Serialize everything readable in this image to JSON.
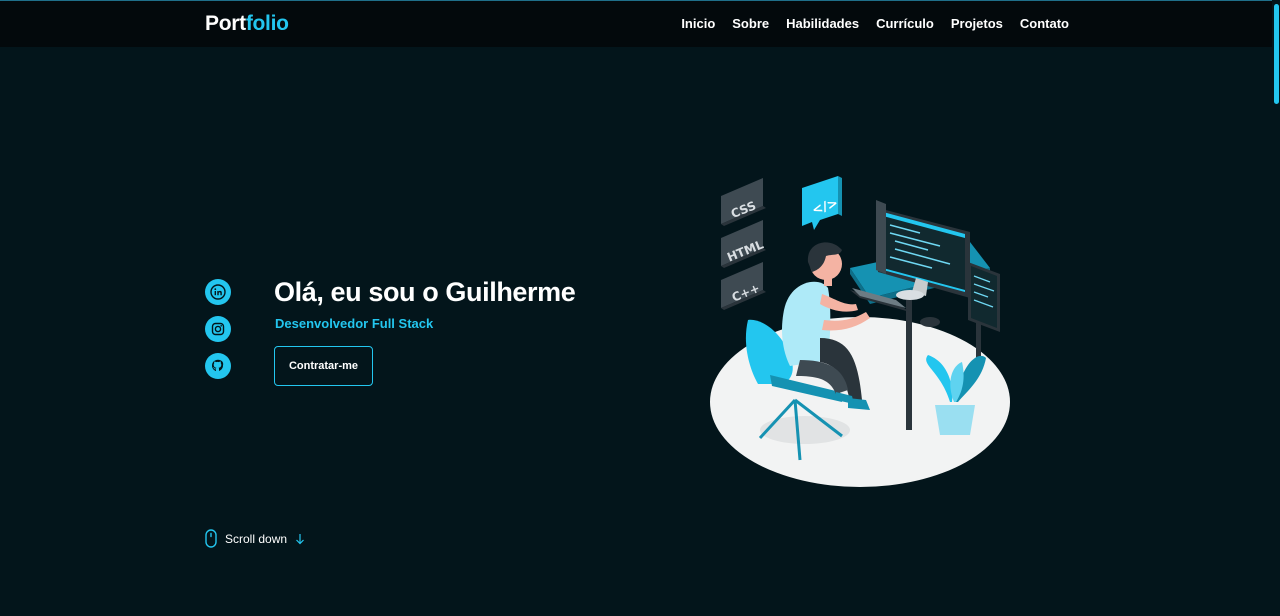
{
  "header": {
    "logo_part1": "Port",
    "logo_part2": "folio",
    "nav": [
      "Inicio",
      "Sobre",
      "Habilidades",
      "Currículo",
      "Projetos",
      "Contato"
    ]
  },
  "hero": {
    "title": "Olá, eu sou o Guilherme",
    "subtitle": "Desenvolvedor Full Stack",
    "cta_label": "Contratar-me",
    "social_icons": [
      "linkedin-icon",
      "instagram-icon",
      "github-icon"
    ]
  },
  "scroll": {
    "label": "Scroll down"
  },
  "illustration": {
    "tags": [
      "CSS",
      "HTML",
      "C++"
    ],
    "code_bubble": "</>"
  },
  "colors": {
    "accent": "#23c6ef",
    "background": "#03151b",
    "header_bg": "#03090c"
  }
}
